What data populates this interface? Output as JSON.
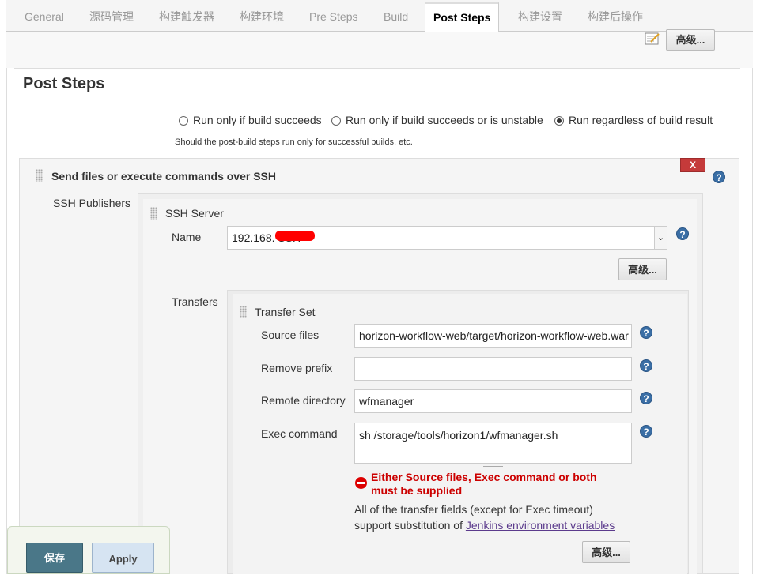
{
  "tabs": [
    "General",
    "源码管理",
    "构建触发器",
    "构建环境",
    "Pre Steps",
    "Build",
    "Post Steps",
    "构建设置",
    "构建后操作"
  ],
  "active_tab": "Post Steps",
  "advanced_label": "高级...",
  "section_title": "Post Steps",
  "run_options": [
    {
      "label": "Run only if build succeeds",
      "selected": false
    },
    {
      "label": "Run only if build succeeds or is unstable",
      "selected": false
    },
    {
      "label": "Run regardless of build result",
      "selected": true
    }
  ],
  "run_hint": "Should the post-build steps run only for successful builds, etc.",
  "step": {
    "title": "Send files or execute commands over SSH",
    "delete_label": "X",
    "publishers_label": "SSH Publishers",
    "server": {
      "title": "SSH Server",
      "name_label": "Name",
      "name_value": "192.168.               SSH",
      "transfers_label": "Transfers",
      "transfer_set": {
        "title": "Transfer Set",
        "source_files_label": "Source files",
        "source_files_value": "horizon-workflow-web/target/horizon-workflow-web.war",
        "remove_prefix_label": "Remove prefix",
        "remove_prefix_value": "",
        "remote_dir_label": "Remote directory",
        "remote_dir_value": "wfmanager",
        "exec_label": "Exec command",
        "exec_value": "sh /storage/tools/horizon1/wfmanager.sh",
        "error": "Either Source files, Exec command or both must be supplied",
        "note_text": "All of the transfer fields (except for Exec timeout) support substitution of ",
        "note_link": "Jenkins environment variables"
      }
    }
  },
  "help_glyph": "?",
  "footer": {
    "save_label": "保存",
    "apply_label": "Apply"
  }
}
